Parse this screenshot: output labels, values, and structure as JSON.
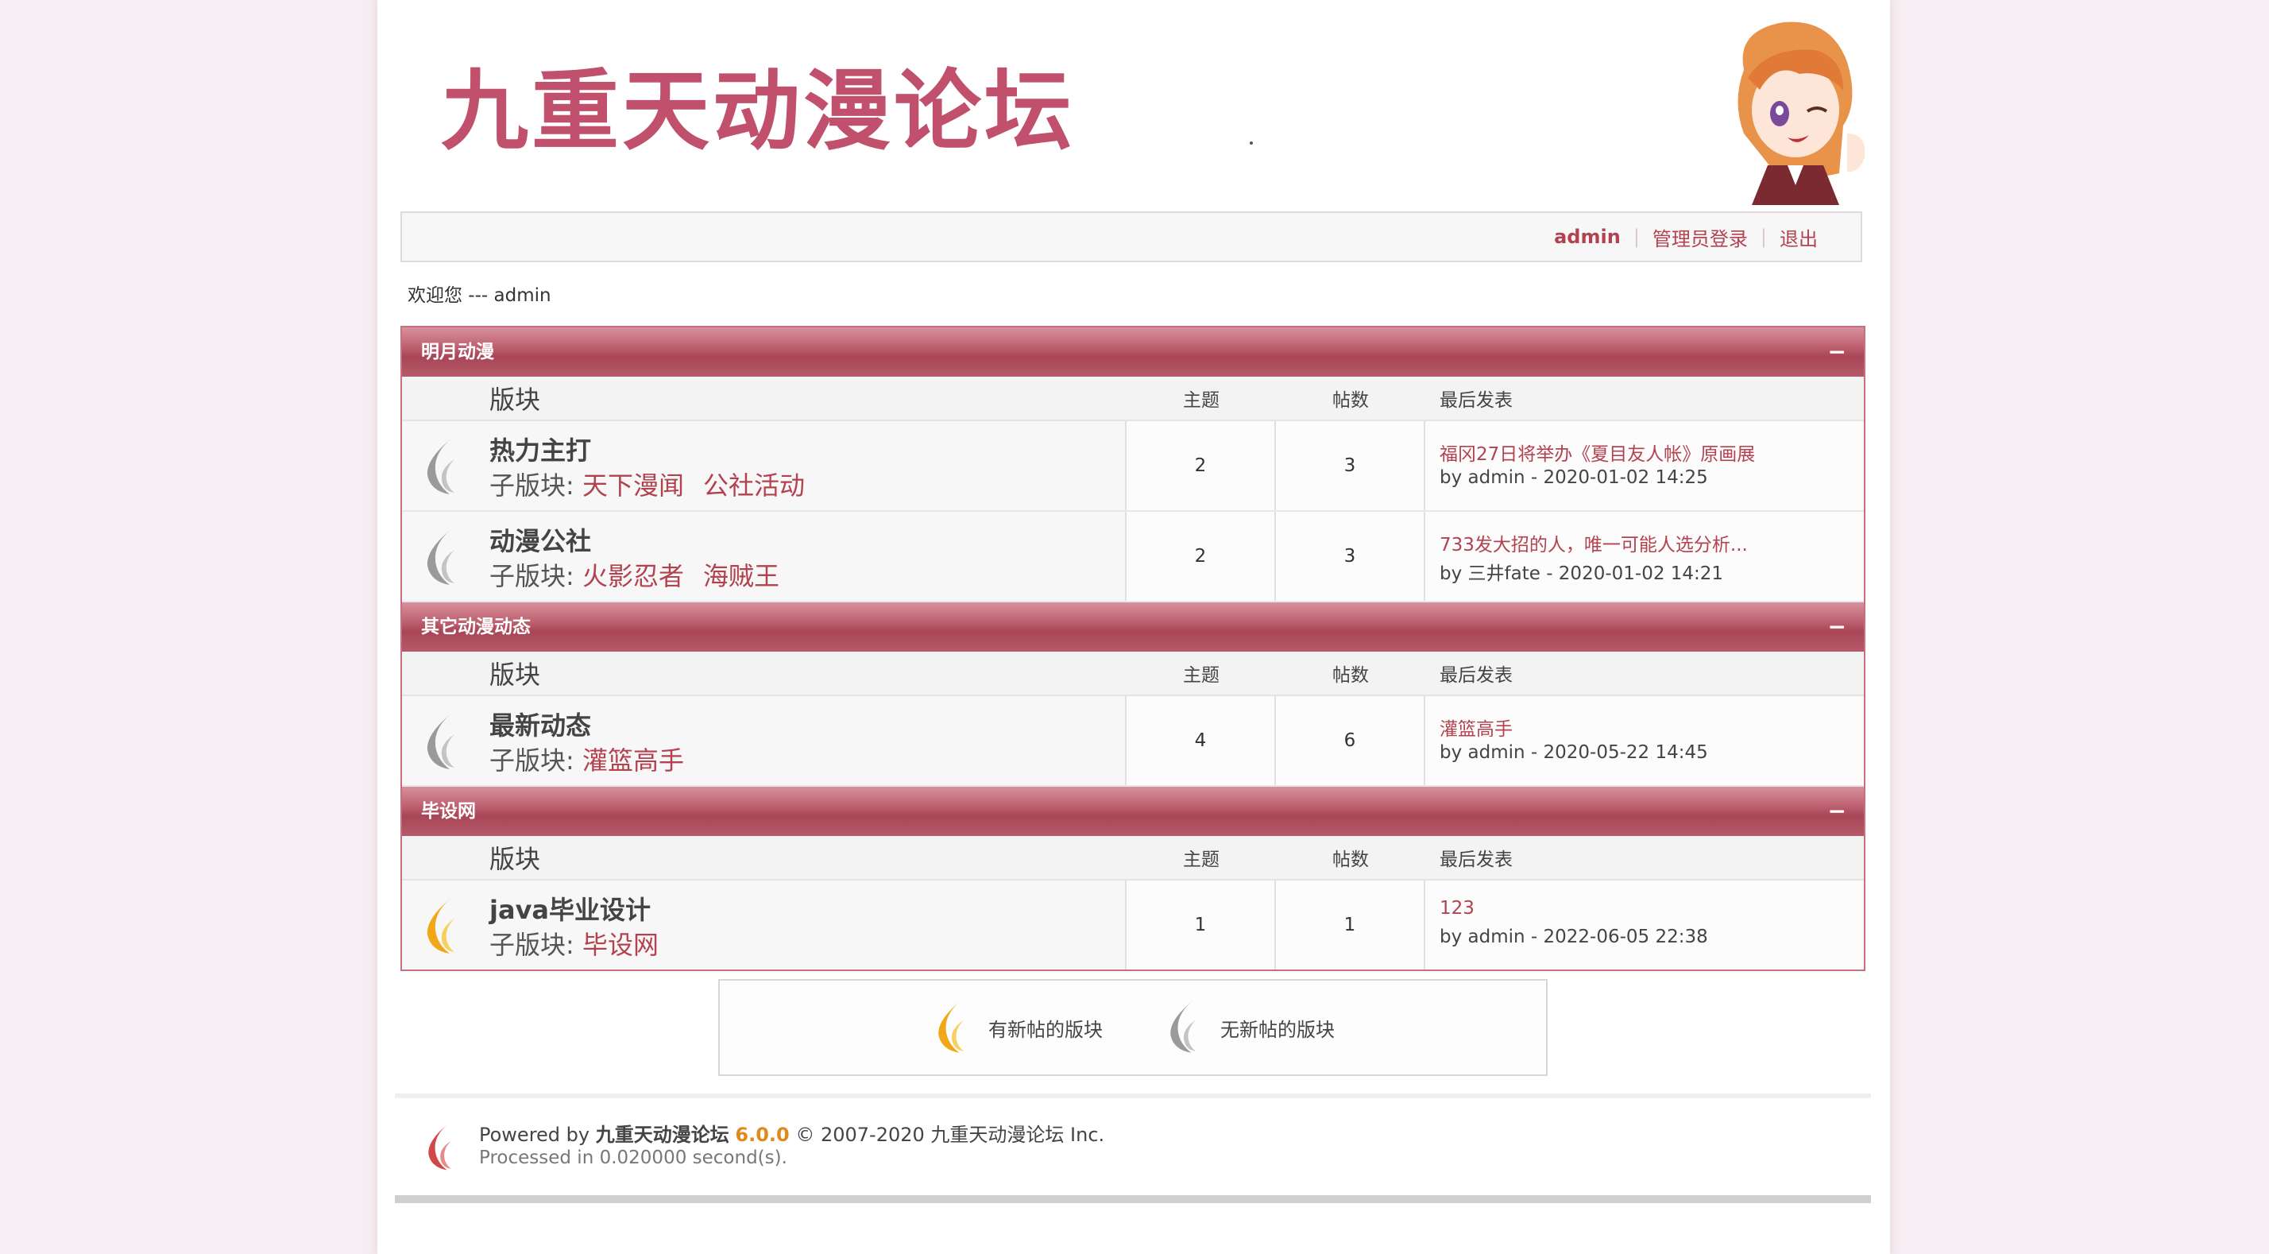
{
  "header": {
    "logo_text": "九重天动漫论坛"
  },
  "userbar": {
    "username": "admin",
    "admin_login": "管理员登录",
    "logout": "退出"
  },
  "welcome": "欢迎您 --- admin",
  "columns": {
    "name": "版块",
    "topics": "主题",
    "posts": "帖数",
    "last": "最后发表"
  },
  "subforum_prefix": "子版块: ",
  "collapse_symbol": "−",
  "categories": [
    {
      "title": "明月动漫",
      "forums": [
        {
          "name": "热力主打",
          "subs": [
            "天下漫闻",
            "公社活动"
          ],
          "topics": "2",
          "posts": "3",
          "last_title": "福冈27日将举办《夏目友人帐》原画展",
          "last_by": "by admin - 2020-01-02 14:25",
          "has_new": false
        },
        {
          "name": "动漫公社",
          "subs": [
            "火影忍者",
            "海贼王"
          ],
          "topics": "2",
          "posts": "3",
          "last_title": "733发大招的人，唯一可能人选分析...",
          "last_by": "by 三井fate - 2020-01-02 14:21",
          "has_new": false
        }
      ]
    },
    {
      "title": "其它动漫动态",
      "forums": [
        {
          "name": "最新动态",
          "subs": [
            "灌篮高手"
          ],
          "topics": "4",
          "posts": "6",
          "last_title": "灌篮高手",
          "last_by": "by admin - 2020-05-22 14:45",
          "has_new": false
        }
      ]
    },
    {
      "title": "毕设网",
      "forums": [
        {
          "name": "java毕业设计",
          "subs": [
            "毕设网"
          ],
          "topics": "1",
          "posts": "1",
          "last_title": "123",
          "last_by": "by admin - 2022-06-05 22:38",
          "has_new": true
        }
      ]
    }
  ],
  "legend": {
    "new": "有新帖的版块",
    "no_new": "无新帖的版块"
  },
  "footer": {
    "powered_prefix": "Powered by ",
    "site": "九重天动漫论坛",
    "version": "6.0.0",
    "copyright": " © 2007-2020 九重天动漫论坛 Inc.",
    "processed": "Processed in 0.020000 second(s)."
  },
  "colors": {
    "accent": "#b3424f",
    "category_bar": "#b55b6b",
    "new_flame": "#f0a818",
    "old_flame": "#9a9a9a"
  }
}
